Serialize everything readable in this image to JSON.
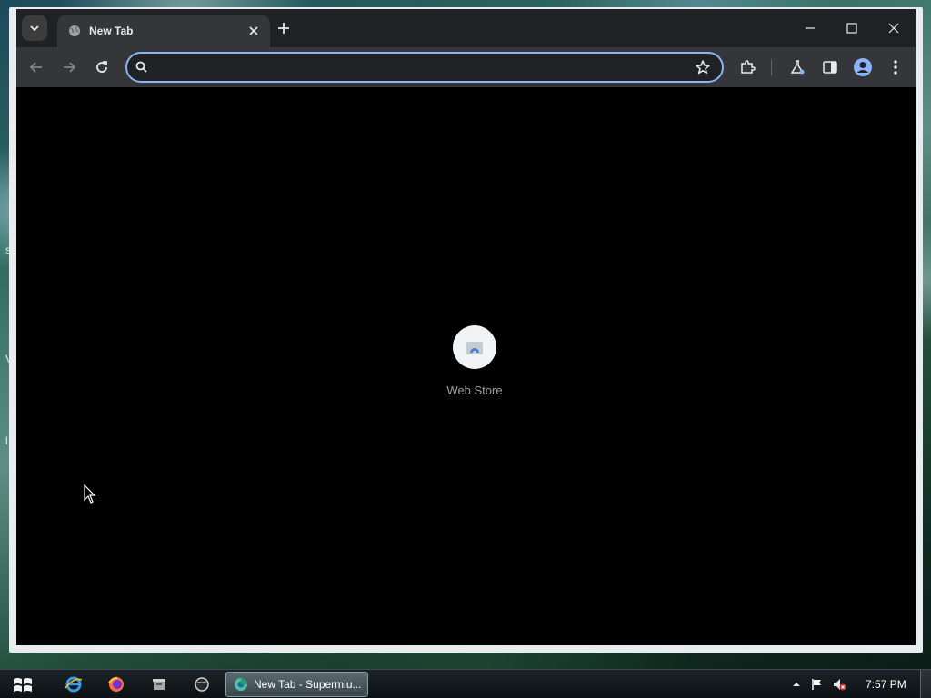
{
  "browser": {
    "tab": {
      "title": "New Tab"
    },
    "omnibox": {
      "value": "",
      "placeholder": ""
    },
    "content": {
      "shortcuts": [
        {
          "label": "Web Store",
          "icon": "web-store-icon"
        }
      ],
      "background_color": "#000000"
    },
    "colors": {
      "accent": "#8ab4f8",
      "tabstrip": "#202124",
      "toolbar": "#35363a"
    }
  },
  "taskbar": {
    "pinned": [
      {
        "name": "internet-explorer-icon"
      },
      {
        "name": "firefox-icon"
      },
      {
        "name": "file-manager-icon"
      },
      {
        "name": "media-player-icon"
      }
    ],
    "active_window": {
      "label": "New Tab - Supermiu..."
    },
    "clock": "7:57 PM"
  }
}
